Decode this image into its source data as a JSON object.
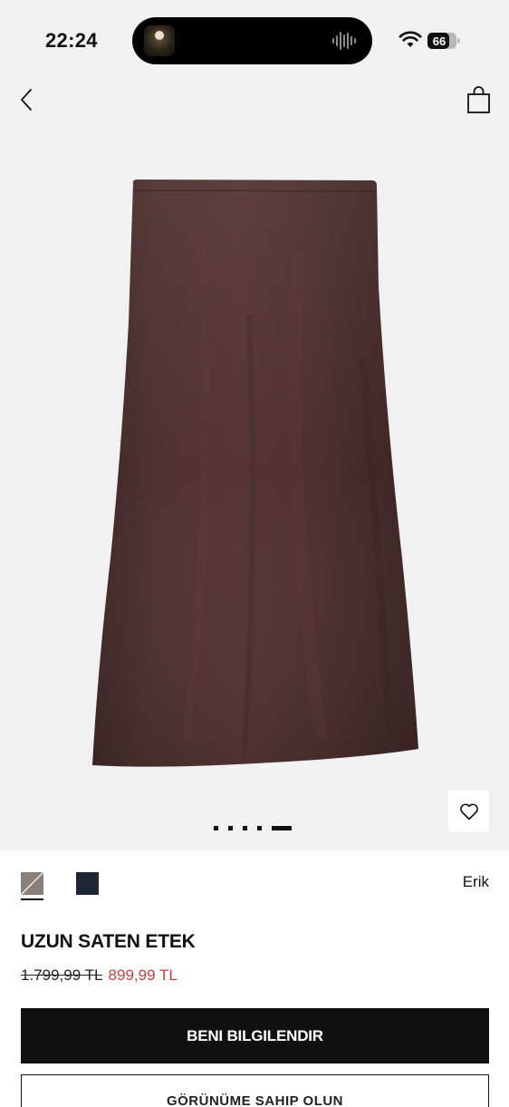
{
  "status_bar": {
    "time": "22:24",
    "battery": "66"
  },
  "header": {
    "back_icon": "chevron-left-icon",
    "bag_icon": "shopping-bag-icon"
  },
  "gallery": {
    "image_count": 5,
    "active_index": 5,
    "wishlist_icon": "heart-icon"
  },
  "colors": {
    "options": [
      "#8a7f7a",
      "#1f2633"
    ],
    "selected_index": 0,
    "selected_name": "Erik"
  },
  "product": {
    "title": "UZUN SATEN ETEK",
    "old_price": "1.799,99 TL",
    "new_price": "899,99 TL",
    "price_color": "#c4403f"
  },
  "actions": {
    "notify_label": "BENI BILGILENDIR",
    "look_label": "GÖRÜNÜME SAHIP OLUN"
  }
}
